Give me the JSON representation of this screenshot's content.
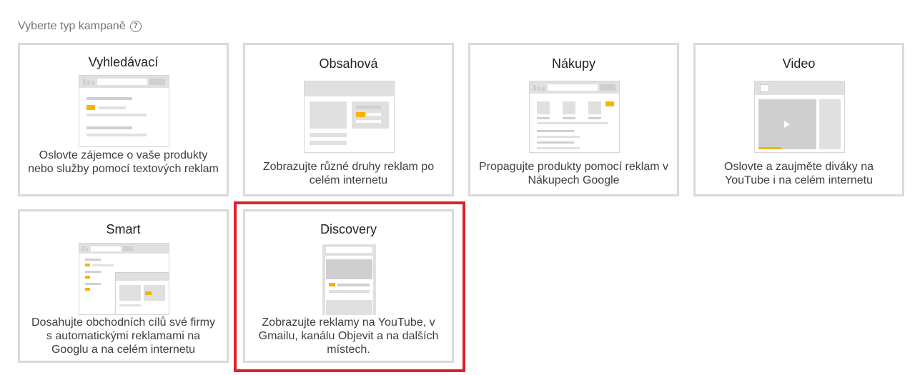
{
  "page": {
    "heading": "Vyberte typ kampaně",
    "help_icon": "help-circle-icon"
  },
  "cards": [
    {
      "title": "Vyhledávací",
      "description": "Oslovte zájemce o vaše produkty nebo služby pomocí textových reklam",
      "illustration": "search-illustration"
    },
    {
      "title": "Obsahová",
      "description": "Zobrazujte různé druhy reklam po celém internetu",
      "illustration": "display-illustration"
    },
    {
      "title": "Nákupy",
      "description": "Propagujte produkty pomocí reklam v Nákupech Google",
      "illustration": "shopping-illustration"
    },
    {
      "title": "Video",
      "description": "Oslovte a zaujměte diváky na YouTube i na celém internetu",
      "illustration": "video-illustration"
    },
    {
      "title": "Smart",
      "description": "Dosahujte obchodních cílů své firmy s automatickými reklamami na Googlu a na celém internetu",
      "illustration": "smart-illustration"
    },
    {
      "title": "Discovery",
      "description": "Zobrazujte reklamy na YouTube, v Gmailu, kanálu Objevit a na dalších místech.",
      "illustration": "discovery-illustration",
      "selected": true
    }
  ],
  "colors": {
    "accent_yellow": "#f4b400",
    "selection_red": "#e0202a",
    "card_border": "#dadada"
  }
}
